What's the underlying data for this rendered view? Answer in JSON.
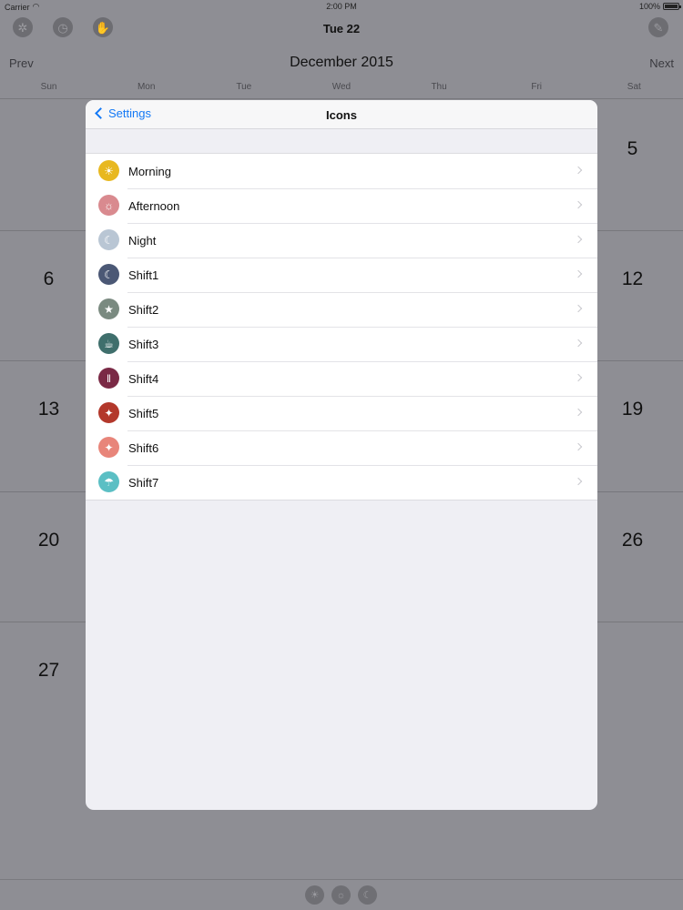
{
  "status_bar": {
    "carrier": "Carrier",
    "time": "2:00 PM",
    "battery": "100%"
  },
  "toolbar": {
    "title": "Tue 22",
    "icons": [
      "settings-icon",
      "clock-icon",
      "hand-icon",
      "brush-icon"
    ]
  },
  "month_nav": {
    "prev": "Prev",
    "title": "December 2015",
    "next": "Next"
  },
  "weekdays": [
    "Sun",
    "Mon",
    "Tue",
    "Wed",
    "Thu",
    "Fri",
    "Sat"
  ],
  "calendar_visible_days": {
    "sat_week1": "5",
    "sun_week2": "6",
    "sat_week2": "12",
    "sun_week3": "13",
    "sat_week3": "19",
    "sun_week4": "20",
    "sat_week4": "26",
    "sun_week5": "27"
  },
  "modal": {
    "back_label": "Settings",
    "title": "Icons",
    "items": [
      {
        "label": "Morning",
        "icon": "sun-icon",
        "color": "#e8b820",
        "glyph": "☀"
      },
      {
        "label": "Afternoon",
        "icon": "sunset-icon",
        "color": "#d98a8f",
        "glyph": "☼"
      },
      {
        "label": "Night",
        "icon": "moon-icon",
        "color": "#b9c6d4",
        "glyph": "☾"
      },
      {
        "label": "Shift1",
        "icon": "night-moon-icon",
        "color": "#4b5875",
        "glyph": "☾"
      },
      {
        "label": "Shift2",
        "icon": "star-icon",
        "color": "#7a8a80",
        "glyph": "★"
      },
      {
        "label": "Shift3",
        "icon": "cup-icon",
        "color": "#3f6f6c",
        "glyph": "☕"
      },
      {
        "label": "Shift4",
        "icon": "cutlery-icon",
        "color": "#7a2945",
        "glyph": "‖"
      },
      {
        "label": "Shift5",
        "icon": "runner-icon",
        "color": "#b3382b",
        "glyph": "✦"
      },
      {
        "label": "Shift6",
        "icon": "running-icon",
        "color": "#e8857a",
        "glyph": "✦"
      },
      {
        "label": "Shift7",
        "icon": "umbrella-icon",
        "color": "#5bbfc4",
        "glyph": "☂"
      }
    ]
  },
  "bottom_bar": {
    "icons": [
      "sun-icon",
      "sunset-icon",
      "moon-icon"
    ]
  }
}
